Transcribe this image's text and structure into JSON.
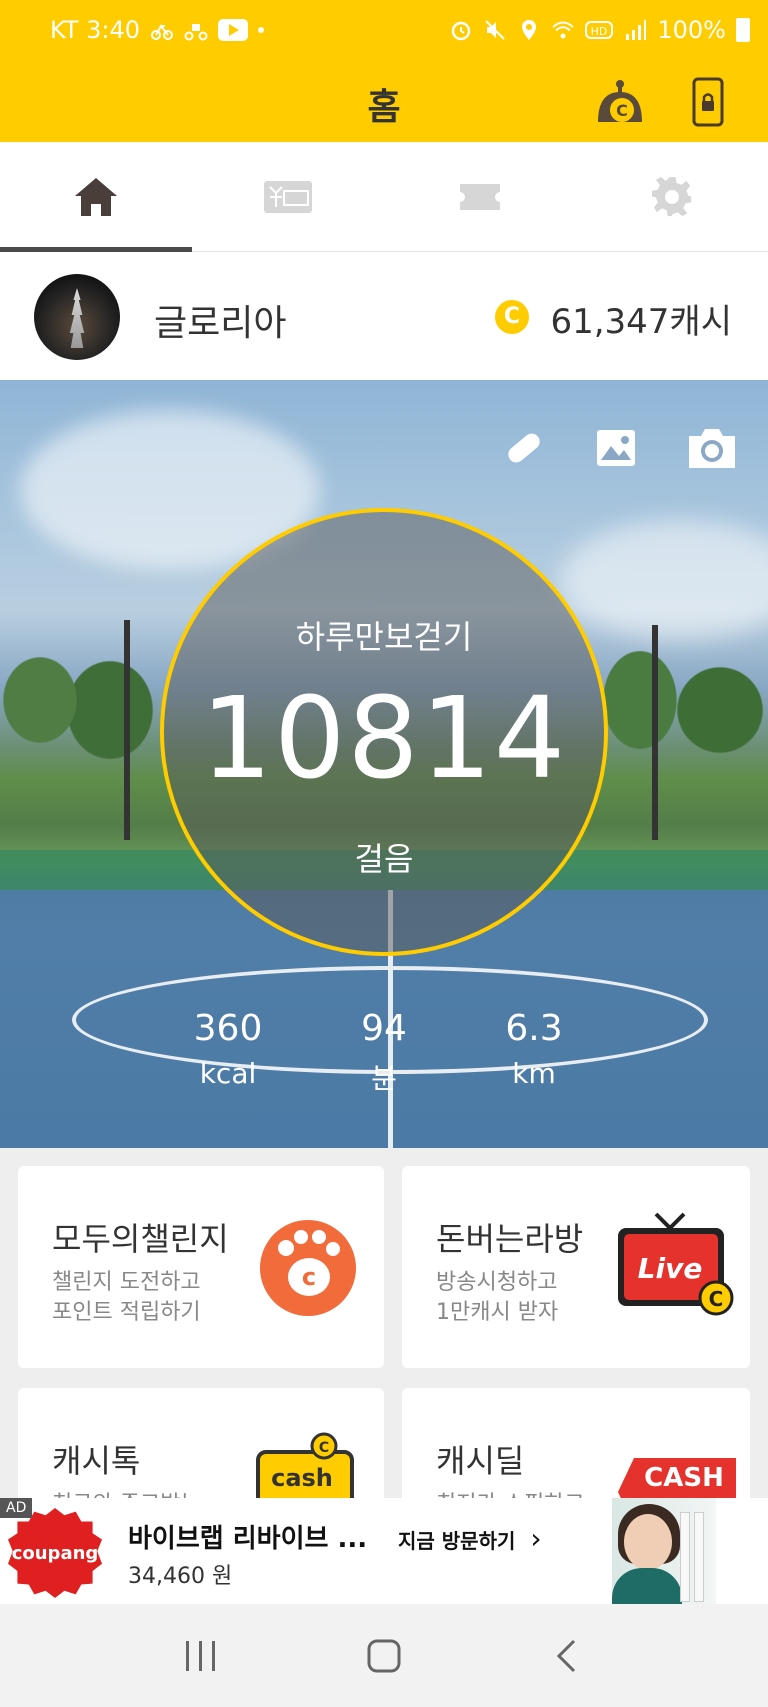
{
  "status_bar": {
    "carrier_time": "KT 3:40",
    "battery": "100%"
  },
  "header": {
    "title": "홈"
  },
  "tabs": [
    {
      "name": "home",
      "active": true
    },
    {
      "name": "gift",
      "active": false
    },
    {
      "name": "ticket",
      "active": false
    },
    {
      "name": "settings",
      "active": false
    }
  ],
  "profile": {
    "username": "글로리아",
    "cash": "61,347캐시",
    "coin_symbol": "C"
  },
  "pedometer": {
    "label": "하루만보걷기",
    "steps": "10814",
    "unit": "걸음",
    "stats": [
      {
        "value": "360",
        "unit": "kcal"
      },
      {
        "value": "94",
        "unit": "분"
      },
      {
        "value": "6.3",
        "unit": "km"
      }
    ]
  },
  "cards": [
    {
      "title": "모두의챌린지",
      "line1": "챌린지 도전하고",
      "line2": "포인트 적립하기"
    },
    {
      "title": "돈버는라방",
      "line1": "방송시청하고",
      "line2": "1만캐시 받자",
      "badge": "Live"
    },
    {
      "title": "캐시톡",
      "line1": "친구와 주고받는",
      "badge": "cash"
    },
    {
      "title": "캐시딜",
      "line1": "최저가 쇼핑하고",
      "badge": "CASH"
    }
  ],
  "ad": {
    "label": "AD",
    "brand": "coupang",
    "title": "바이브랩 리바이브 ...",
    "price": "34,460 원",
    "cta": "지금 방문하기",
    "cta_arrow": "›"
  },
  "colors": {
    "brand_yellow": "#ffcc00",
    "text_dark": "#333333",
    "paw_orange": "#f26b3a",
    "live_red": "#e5322d",
    "coupang_red": "#e02020"
  }
}
